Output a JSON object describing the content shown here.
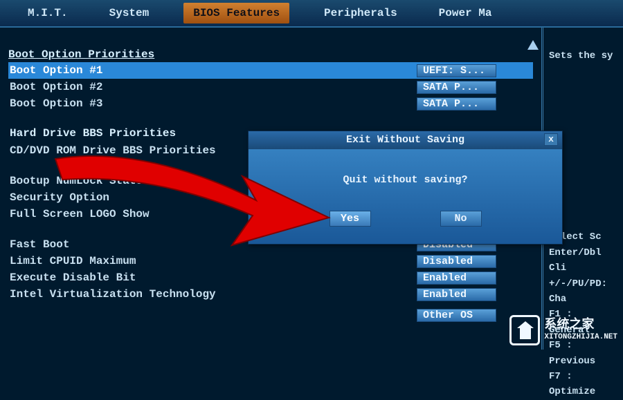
{
  "tabs": {
    "items": [
      "M.I.T.",
      "System",
      "BIOS Features",
      "Peripherals",
      "Power Ma"
    ],
    "active_index": 2
  },
  "sections": {
    "boot_priorities_title": "Boot Option Priorities",
    "boot_options": [
      {
        "label": "Boot Option #1",
        "value": "UEFI: S...",
        "selected": true
      },
      {
        "label": "Boot Option #2",
        "value": "SATA  P...",
        "selected": false
      },
      {
        "label": "Boot Option #3",
        "value": "SATA  P...",
        "selected": false
      }
    ],
    "hdd_bbs": "Hard Drive BBS Priorities",
    "cddvd_bbs": "CD/DVD ROM Drive BBS Priorities",
    "misc": [
      {
        "label": "Bootup NumLock State",
        "value": ""
      },
      {
        "label": "Security Option",
        "value": ""
      },
      {
        "label": "Full Screen LOGO Show",
        "value": ""
      }
    ],
    "lower": [
      {
        "label": "Fast Boot",
        "value": "Disabled"
      },
      {
        "label": "Limit CPUID Maximum",
        "value": "Disabled"
      },
      {
        "label": "Execute Disable Bit",
        "value": "Enabled"
      },
      {
        "label": "Intel Virtualization Technology",
        "value": "Enabled"
      }
    ],
    "bottom_value": "Other OS"
  },
  "help": {
    "top": "Sets the sy",
    "select_sc": "Select Sc",
    "lines": [
      "Enter/Dbl Cli",
      "+/-/PU/PD: Cha",
      "F1  : General",
      "F5  : Previous",
      "F7  : Optimize"
    ]
  },
  "dialog": {
    "title": "Exit Without Saving",
    "message": "Quit without saving?",
    "yes": "Yes",
    "no": "No"
  },
  "watermark": {
    "line1": "系统之家",
    "line2": "XITONGZHIJIA.NET"
  }
}
